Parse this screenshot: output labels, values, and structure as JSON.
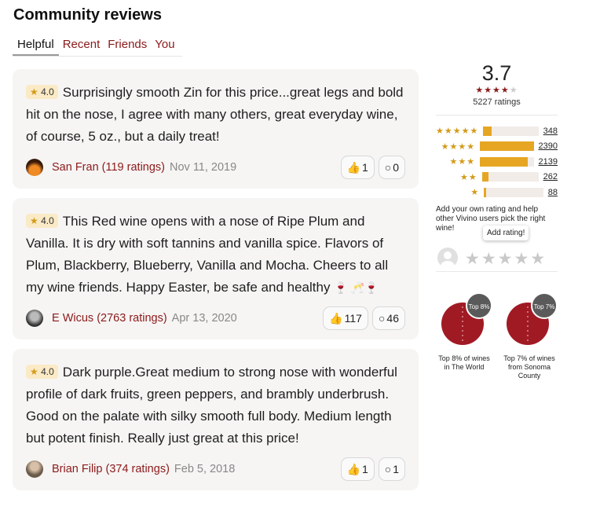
{
  "title": "Community reviews",
  "tabs": [
    "Helpful",
    "Recent",
    "Friends",
    "You"
  ],
  "reviews": [
    {
      "rating": "4.0",
      "text": "Surprisingly smooth Zin for this price...great legs and bold hit on the nose, I agree with many others, great everyday wine, of course, 5 oz., but a daily treat!",
      "emoji": "",
      "user": "San Fran (119 ratings)",
      "date": "Nov 11, 2019",
      "likes": "1",
      "comments": "0",
      "avatar_color": "#c85a1a"
    },
    {
      "rating": "4.0",
      "text": "This Red wine opens with a nose of Ripe Plum and Vanilla. It is dry with soft tannins and vanilla spice. Flavors of Plum, Blackberry, Blueberry, Vanilla and Mocha. Cheers to all my wine friends. Happy Easter, be safe and healthy",
      "emoji": "🍷 🥂🍷",
      "user": "E Wicus (2763 ratings)",
      "date": "Apr 13, 2020",
      "likes": "117",
      "comments": "46",
      "avatar_color": "#555555"
    },
    {
      "rating": "4.0",
      "text": "Dark purple.Great medium to strong nose with wonderful profile of dark fruits, green peppers, and brambly underbrush. Good on the palate with silky smooth full body. Medium length but potent finish. Really just great at this price!",
      "emoji": "",
      "user": "Brian Filip (374 ratings)",
      "date": "Feb 5, 2018",
      "likes": "1",
      "comments": "1",
      "avatar_color": "#8a7a6a"
    }
  ],
  "summary": {
    "average": "3.7",
    "ratings_count": "5227 ratings",
    "distribution": [
      {
        "stars": "★★★★★",
        "count": "348",
        "share": 0.146
      },
      {
        "stars": "★★★★",
        "count": "2390",
        "share": 1.0
      },
      {
        "stars": "★★★",
        "count": "2139",
        "share": 0.895
      },
      {
        "stars": "★★",
        "count": "262",
        "share": 0.11
      },
      {
        "stars": "★",
        "count": "88",
        "share": 0.037
      }
    ],
    "add_rating_text": "Add your own rating and help other Vivino users pick the right wine!",
    "add_rating_tooltip": "Add rating!"
  },
  "badges": [
    {
      "pct": "Top 8%",
      "label": "Top 8% of wines in The World"
    },
    {
      "pct": "Top 7%",
      "label": "Top 7% of wines from Sonoma County"
    }
  ],
  "colors": {
    "brand": "#8b1a1a",
    "star": "#d29b18",
    "bar": "#e6a623"
  }
}
